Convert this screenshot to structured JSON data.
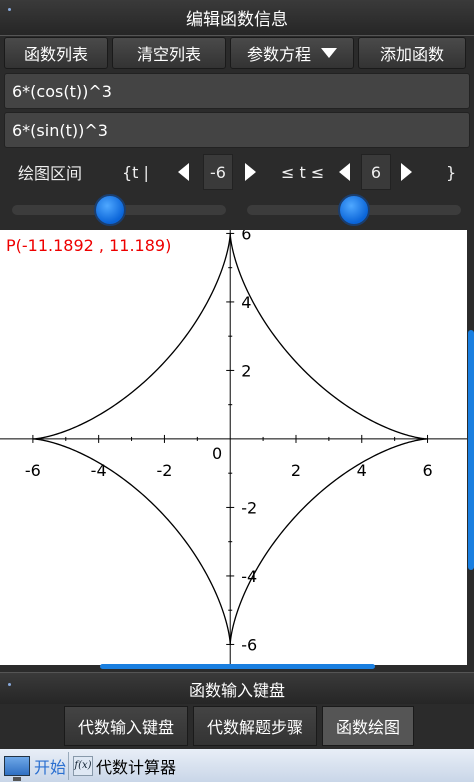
{
  "window": {
    "title": "编辑函数信息"
  },
  "toolbar": {
    "function_list": "函数列表",
    "clear_list": "清空列表",
    "mode_select": "参数方程",
    "add_function": "添加函数"
  },
  "inputs": {
    "x_expr": "6*(cos(t))^3",
    "y_expr": "6*(sin(t))^3"
  },
  "range": {
    "label": "绘图区间",
    "open": "{t |",
    "min_value": "-6",
    "relation": "≤ t ≤",
    "max_value": "6",
    "close": "}"
  },
  "sliders": {
    "min_position": 0.46,
    "max_position": 0.5
  },
  "plot": {
    "coordinate": "P(-11.1892 , 11.189)",
    "origin_label": "0",
    "x_ticks": [
      "-6",
      "-4",
      "-2",
      "2",
      "4",
      "6"
    ],
    "y_ticks": [
      "6",
      "4",
      "2",
      "-2",
      "-4",
      "-6"
    ],
    "axis_color": "#000000",
    "coord_color": "#e00000"
  },
  "chart_data": {
    "type": "line",
    "title": "",
    "xlabel": "",
    "ylabel": "",
    "x_tick_values": [
      -6,
      -4,
      -2,
      2,
      4,
      6
    ],
    "y_tick_values": [
      -6,
      -4,
      -2,
      2,
      4,
      6
    ],
    "xlim": [
      -7,
      7.2
    ],
    "ylim": [
      -6.6,
      6.1
    ],
    "series": [
      {
        "x_expr": "6*(cos(t))^3",
        "y_expr": "6*(sin(t))^3",
        "t_range": [
          -6,
          6
        ]
      }
    ]
  },
  "keyboard_bar": {
    "label": "函数输入键盘"
  },
  "tabs": [
    {
      "label": "代数输入键盘"
    },
    {
      "label": "代数解题步骤"
    },
    {
      "label": "函数绘图"
    }
  ],
  "taskbar": {
    "start": "开始",
    "app_icon": "f(x)",
    "app": "代数计算器"
  }
}
